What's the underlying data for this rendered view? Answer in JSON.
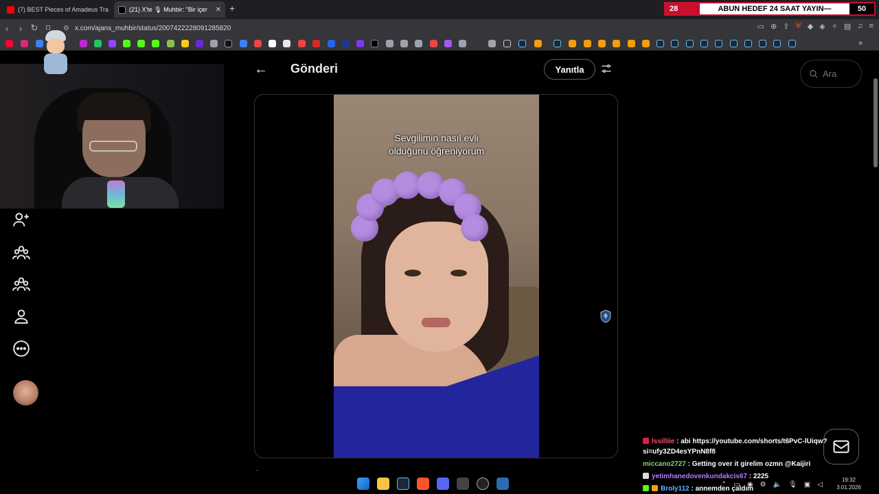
{
  "browser": {
    "tabs": [
      {
        "title": "(7) BEST Pieces of Amadeus Travis Sc",
        "icon_color": "#ff0000"
      },
      {
        "title": "(21) X'te 🎙 Muhbir: \"Bir içer",
        "icon_color": "#ffffff"
      }
    ],
    "close_glyph": "✕",
    "new_tab_glyph": "+",
    "url": "x.com/ajans_muhbir/status/2007422228091285820"
  },
  "stream_banner": {
    "left": "28",
    "text": "ABUN HEDEF 24 SAAT YAYIN—",
    "right": "50"
  },
  "page": {
    "back_glyph": "←",
    "title": "Gönderi",
    "reply_label": "Yanıtla",
    "search_placeholder": "Ara"
  },
  "video": {
    "caption_line1": "Sevgilimin nasıl evli",
    "caption_line2": "olduğunu öğreniyorum"
  },
  "chat": [
    {
      "user": "lssilliie",
      "text": "abi https://youtube.com/shorts/t6PvC-lUiqw?si=ufy3ZD4esYPnN8f8"
    },
    {
      "user": "miccano2727",
      "text": "Getting over it girelim ozmn @Kaijiri"
    },
    {
      "user": "yetimhanedovenkundakcis67",
      "text": "2225"
    },
    {
      "user": "Broly112",
      "text": "annemden çaldım"
    }
  ],
  "clock": {
    "time": "19:32",
    "date": "3.01.2026"
  },
  "below_text": "..",
  "colors": {
    "accent_red": "#c8102e",
    "x_border": "#2f3336",
    "x_text": "#e7e9ea"
  }
}
